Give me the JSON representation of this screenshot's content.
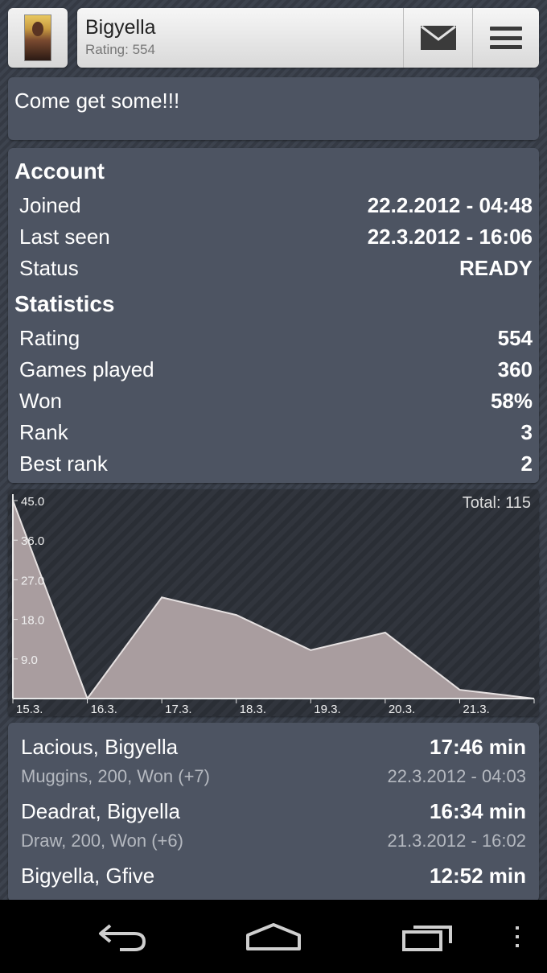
{
  "header": {
    "player_name": "Bigyella",
    "rating_text": "Rating: 554"
  },
  "motto": "Come get some!!!",
  "account": {
    "title": "Account",
    "rows": [
      {
        "label": "Joined",
        "value": "22.2.2012 - 04:48"
      },
      {
        "label": "Last seen",
        "value": "22.3.2012 - 16:06"
      },
      {
        "label": "Status",
        "value": "READY"
      }
    ]
  },
  "statistics": {
    "title": "Statistics",
    "rows": [
      {
        "label": "Rating",
        "value": "554"
      },
      {
        "label": "Games played",
        "value": "360"
      },
      {
        "label": "Won",
        "value": "58%"
      },
      {
        "label": "Rank",
        "value": "3"
      },
      {
        "label": "Best rank",
        "value": "2"
      }
    ]
  },
  "chart_data": {
    "type": "area",
    "total_label": "Total: 115",
    "x": [
      "15.3.",
      "16.3.",
      "17.3.",
      "18.3.",
      "19.3.",
      "20.3.",
      "21.3.",
      ""
    ],
    "values": [
      45,
      0,
      23,
      19,
      11,
      15,
      2,
      0
    ],
    "yticks": [
      "45.0",
      "36.0",
      "27.0",
      "18.0",
      "9.0"
    ],
    "ylim": [
      0,
      45
    ],
    "fill_color": "#a99d9f",
    "line_color": "#e6e1e1"
  },
  "games": [
    {
      "players": "Lacious, Bigyella",
      "duration": "17:46 min",
      "details": "Muggins, 200, Won (+7)",
      "date": "22.3.2012 - 04:03"
    },
    {
      "players": "Deadrat, Bigyella",
      "duration": "16:34 min",
      "details": "Draw, 200, Won (+6)",
      "date": "21.3.2012 - 16:02"
    },
    {
      "players": "Bigyella, Gfive",
      "duration": "12:52 min",
      "details": "",
      "date": ""
    }
  ],
  "icons": {
    "mail": "mail-icon",
    "menu": "menu-icon",
    "back": "back-icon",
    "home": "home-icon",
    "recents": "recent-apps-icon",
    "overflow": "overflow-menu-icon"
  }
}
